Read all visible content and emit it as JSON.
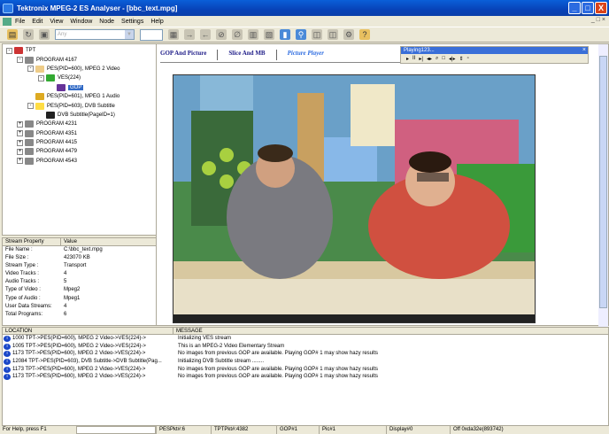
{
  "window": {
    "title": "Tektronix MPEG-2 ES Analyser - [bbc_text.mpg]",
    "btn_min": "_",
    "btn_max": "□",
    "btn_close": "X",
    "mdi_controls": "_ □ ×"
  },
  "menu": [
    "File",
    "Edit",
    "View",
    "Window",
    "Node",
    "Settings",
    "Help"
  ],
  "toolbar": {
    "combo_value": "Any",
    "combo_arrow": "▼"
  },
  "tree": [
    {
      "label": "TPT",
      "icon": "root-icon",
      "exp": "-",
      "indent": 0
    },
    {
      "label": "PROGRAM 4167",
      "icon": "program-icon",
      "exp": "-",
      "indent": 1
    },
    {
      "label": "PES(PID=600), MPEG 2 Video",
      "icon": "pes-icon",
      "exp": "-",
      "indent": 2
    },
    {
      "label": "VES(224)",
      "icon": "ves-icon",
      "exp": "-",
      "indent": 3
    },
    {
      "label": "GOP",
      "icon": "gop-icon",
      "exp": "",
      "indent": 4,
      "selected": true
    },
    {
      "label": "PES(PID=601), MPEG 1 Audio",
      "icon": "audio-icon",
      "exp": "",
      "indent": 2
    },
    {
      "label": "PES(PID=603), DVB Subtitle",
      "icon": "subtitle-icon",
      "exp": "-",
      "indent": 2
    },
    {
      "label": "DVB Subtitle(PageID=1)",
      "icon": "dvb-icon",
      "exp": "",
      "indent": 3
    },
    {
      "label": "PROGRAM 4231",
      "icon": "program-icon",
      "exp": "+",
      "indent": 1
    },
    {
      "label": "PROGRAM 4351",
      "icon": "program-icon",
      "exp": "+",
      "indent": 1
    },
    {
      "label": "PROGRAM 4415",
      "icon": "program-icon",
      "exp": "+",
      "indent": 1
    },
    {
      "label": "PROGRAM 4479",
      "icon": "program-icon",
      "exp": "+",
      "indent": 1
    },
    {
      "label": "PROGRAM 4543",
      "icon": "program-icon",
      "exp": "+",
      "indent": 1
    }
  ],
  "props": {
    "header_key": "Stream Property",
    "header_value": "Value",
    "rows": [
      {
        "k": "File Name :",
        "v": "C:\\bbc_text.mpg"
      },
      {
        "k": "File Size :",
        "v": "423070 KB"
      },
      {
        "k": "Stream Type :",
        "v": "Transport"
      },
      {
        "k": "Video Tracks :",
        "v": "4"
      },
      {
        "k": "Audio Tracks :",
        "v": "5"
      },
      {
        "k": "Type of Video :",
        "v": "Mpeg2"
      },
      {
        "k": "Type of Audio :",
        "v": "Mpeg1"
      },
      {
        "k": "User Data Streams:",
        "v": "4"
      },
      {
        "k": "Total Programs:",
        "v": "6"
      }
    ]
  },
  "tabs": {
    "gop": "GOP And Picture",
    "slice": "Slice And MB",
    "player": "Picture Player"
  },
  "player": {
    "title": "Playing123...",
    "close": "×",
    "controls": [
      "▸",
      "II",
      "▸|",
      "◂▸",
      "⌕",
      "□",
      "◂|▸",
      "⇕",
      "▫"
    ]
  },
  "log": {
    "col_location": "LOCATION",
    "col_message": "MESSAGE",
    "rows": [
      {
        "loc": "1000 TPT->PES(PID=600), MPEG 2 Video->VES(224)->",
        "msg": "Initializing VES stream"
      },
      {
        "loc": "1005 TPT->PES(PID=600), MPEG 2 Video->VES(224)->",
        "msg": "This is an MPEG-2 Video Elementary Stream"
      },
      {
        "loc": "1173 TPT->PES(PID=600), MPEG 2 Video->VES(224)->",
        "msg": "No images from previous GOP are available. Playing GOP# 1 may show hazy results"
      },
      {
        "loc": "12084 TPT->PES(PID=603), DVB Subtitle->DVB Subtitle(Pag...",
        "msg": "Initializing DVB Subtitle stream ........"
      },
      {
        "loc": "1173 TPT->PES(PID=600), MPEG 2 Video->VES(224)->",
        "msg": "No images from previous GOP are available. Playing GOP# 1 may show hazy results"
      },
      {
        "loc": "1173 TPT->PES(PID=600), MPEG 2 Video->VES(224)->",
        "msg": "No images from previous GOP are available. Playing GOP# 1 may show hazy results"
      }
    ]
  },
  "status": {
    "help": "For Help, press F1",
    "pes": "PESPkt#:6",
    "tpt": "TPTPkt#:4382",
    "gop": "GOP#1",
    "pic": "Pic#1",
    "display": "Display#0",
    "offset": "Off 0xda32e(893742)"
  },
  "info_glyph": "i"
}
